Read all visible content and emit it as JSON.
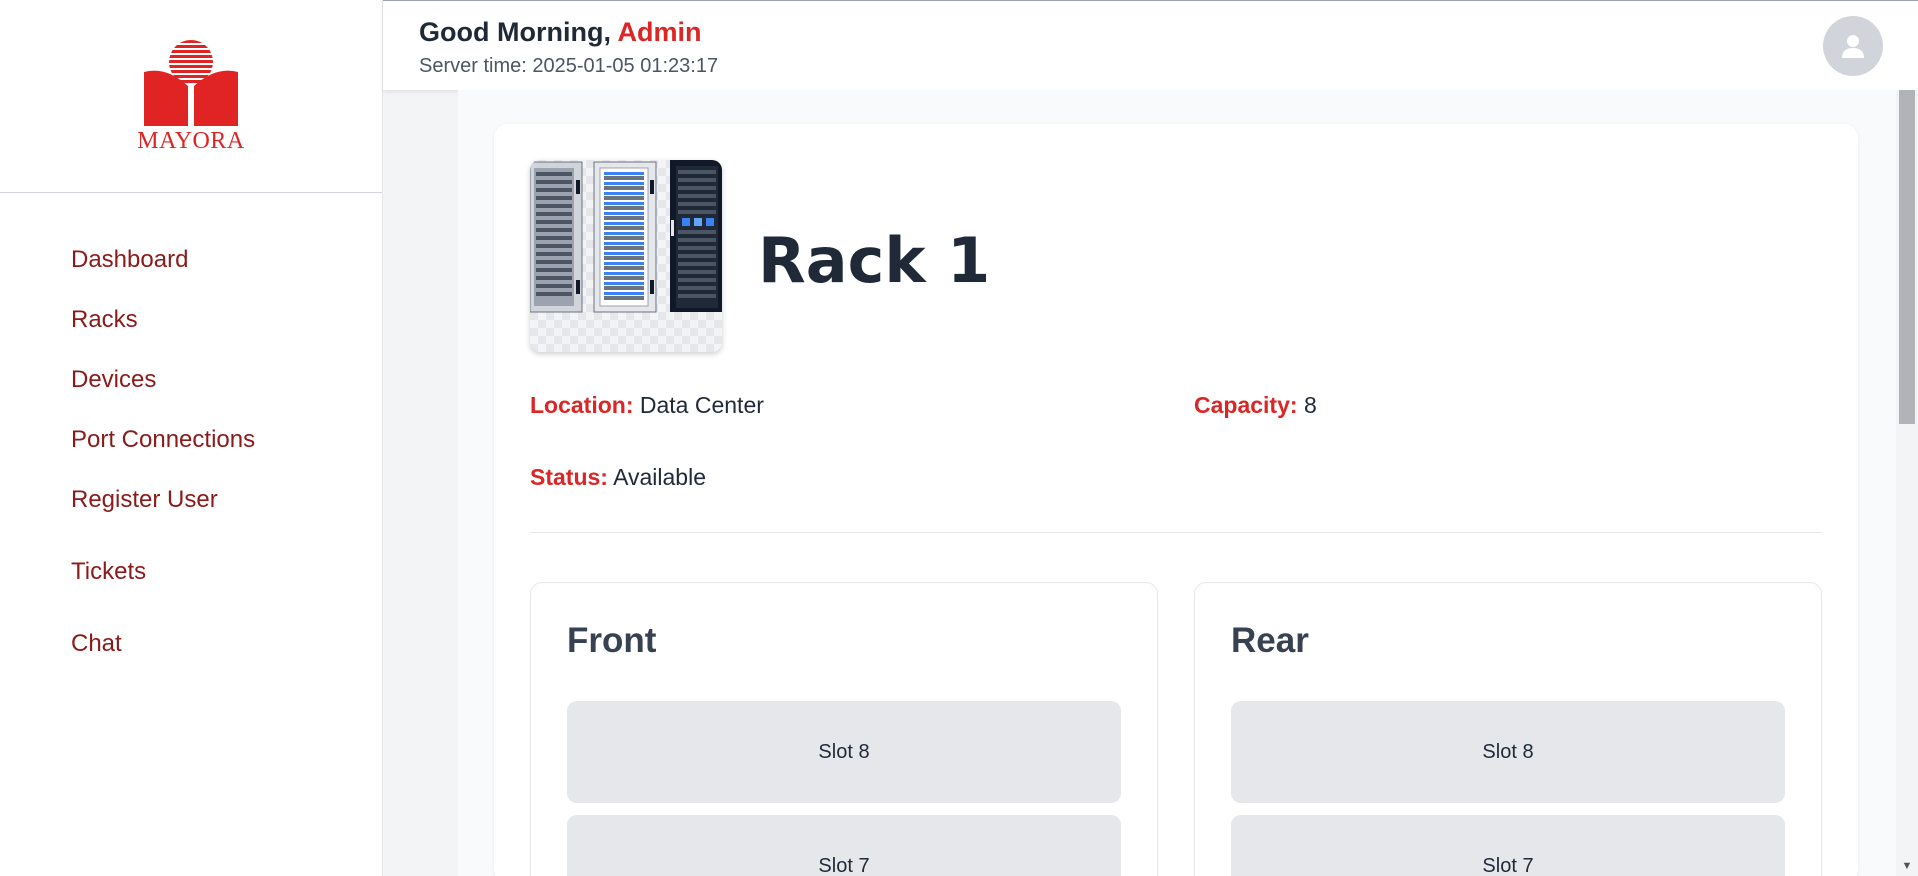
{
  "sidebar": {
    "logo_text": "MAYORA",
    "items": [
      {
        "label": "Dashboard"
      },
      {
        "label": "Racks"
      },
      {
        "label": "Devices"
      },
      {
        "label": "Port Connections"
      },
      {
        "label": "Register User"
      },
      {
        "label": "Tickets"
      },
      {
        "label": "Chat"
      }
    ]
  },
  "header": {
    "greeting": "Good Morning, ",
    "user_name": "Admin",
    "server_time": "Server time: 2025-01-05 01:23:17",
    "avatar_icon": "user-icon"
  },
  "rack": {
    "title": "Rack 1",
    "image_icon": "server-rack-icon",
    "location_label": "Location:",
    "location_value": "Data Center",
    "capacity_label": "Capacity:",
    "capacity_value": "8",
    "status_label": "Status:",
    "status_value": "Available"
  },
  "front": {
    "title": "Front",
    "slots": [
      {
        "label": "Slot 8"
      },
      {
        "label": "Slot 7"
      }
    ]
  },
  "rear": {
    "title": "Rear",
    "slots": [
      {
        "label": "Slot 8"
      },
      {
        "label": "Slot 7"
      }
    ]
  },
  "colors": {
    "accent": "#dc2626",
    "nav_text": "#8b1a1a"
  }
}
